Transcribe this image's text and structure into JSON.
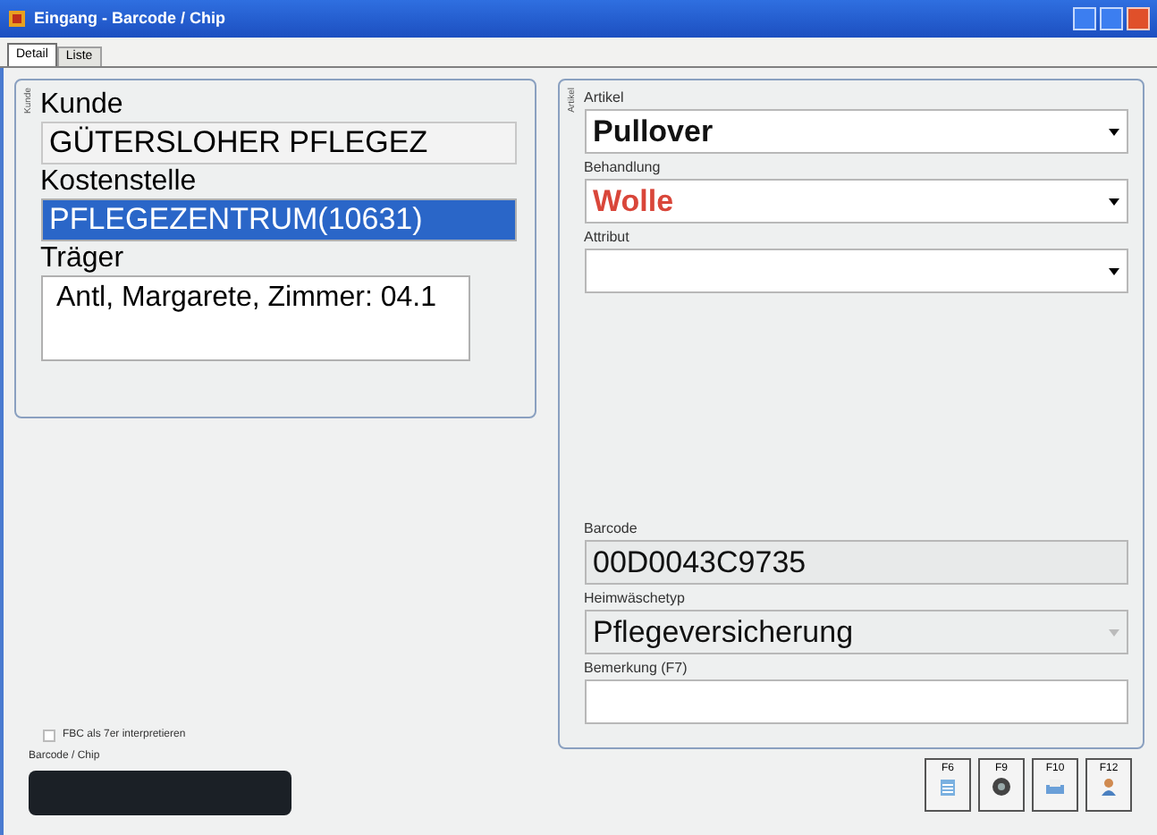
{
  "window": {
    "title": "Eingang - Barcode / Chip"
  },
  "tabs": [
    {
      "label": "Detail",
      "selected": true
    },
    {
      "label": "Liste",
      "selected": false
    }
  ],
  "customer_group": {
    "caption": "Kunde",
    "fields": [
      {
        "label": "Kunde",
        "value": "GÜTERSLOHER PFLEGEZ",
        "kind": "combo",
        "selected": false
      },
      {
        "label": "Kostenstelle",
        "value": "PFLEGEZENTRUM(10631)",
        "kind": "text",
        "selected": true
      },
      {
        "label": "Träger",
        "value": "Antl, Margarete, Zimmer: 04.1",
        "kind": "memo",
        "selected": false
      }
    ]
  },
  "article_group": {
    "caption": "Artikel",
    "fields": [
      {
        "label": "Artikel",
        "value": "Pullover",
        "kind": "dropdown",
        "color": "#111111"
      },
      {
        "label": "Behandlung",
        "value": "Wolle",
        "kind": "dropdown",
        "color": "#d9463a"
      },
      {
        "label": "Attribut",
        "kind": "dropdown"
      },
      {
        "label": "Barcode",
        "value": "00D0043C9735",
        "kind": "readonly",
        "color": "#111111"
      },
      {
        "label": "Heimwäschetyp",
        "value": "Pflegeversicherung",
        "kind": "disabled_dropdown",
        "color": "#111111"
      },
      {
        "label": "Bemerkung (F7)",
        "kind": "text"
      }
    ]
  },
  "option": {
    "label": "FBC als 7er interpretieren",
    "checked": false
  },
  "barcode_chip": {
    "label": "Barcode / Chip"
  },
  "function_keys": [
    {
      "key": "F6",
      "kind": "list"
    },
    {
      "key": "F9",
      "kind": "film"
    },
    {
      "key": "F10",
      "kind": "print"
    },
    {
      "key": "F12",
      "kind": "person"
    }
  ]
}
